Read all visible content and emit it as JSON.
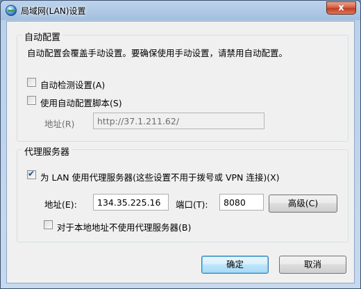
{
  "window": {
    "title": "局域网(LAN)设置",
    "close_label": "x",
    "title_icon": "internet-globe-icon"
  },
  "auto_config": {
    "group_label": "自动配置",
    "description": "自动配置会覆盖手动设置。要确保使用手动设置，请禁用自动配置。",
    "auto_detect": {
      "label": "自动检测设置(A)",
      "checked": false
    },
    "use_script": {
      "label": "使用自动配置脚本(S)",
      "checked": false
    },
    "address_label": "地址(R)",
    "address_value": "http://37.1.211.62/"
  },
  "proxy": {
    "group_label": "代理服务器",
    "use_proxy": {
      "label": "为 LAN 使用代理服务器(这些设置不用于拨号或 VPN 连接)(X)",
      "checked": true
    },
    "address_label": "地址(E):",
    "address_value": "134.35.225.16",
    "port_label": "端口(T):",
    "port_value": "8080",
    "advanced_label": "高级(C)",
    "bypass_local": {
      "label": "对于本地地址不使用代理服务器(B)",
      "checked": false
    }
  },
  "buttons": {
    "ok_label": "确定",
    "cancel_label": "取消"
  }
}
